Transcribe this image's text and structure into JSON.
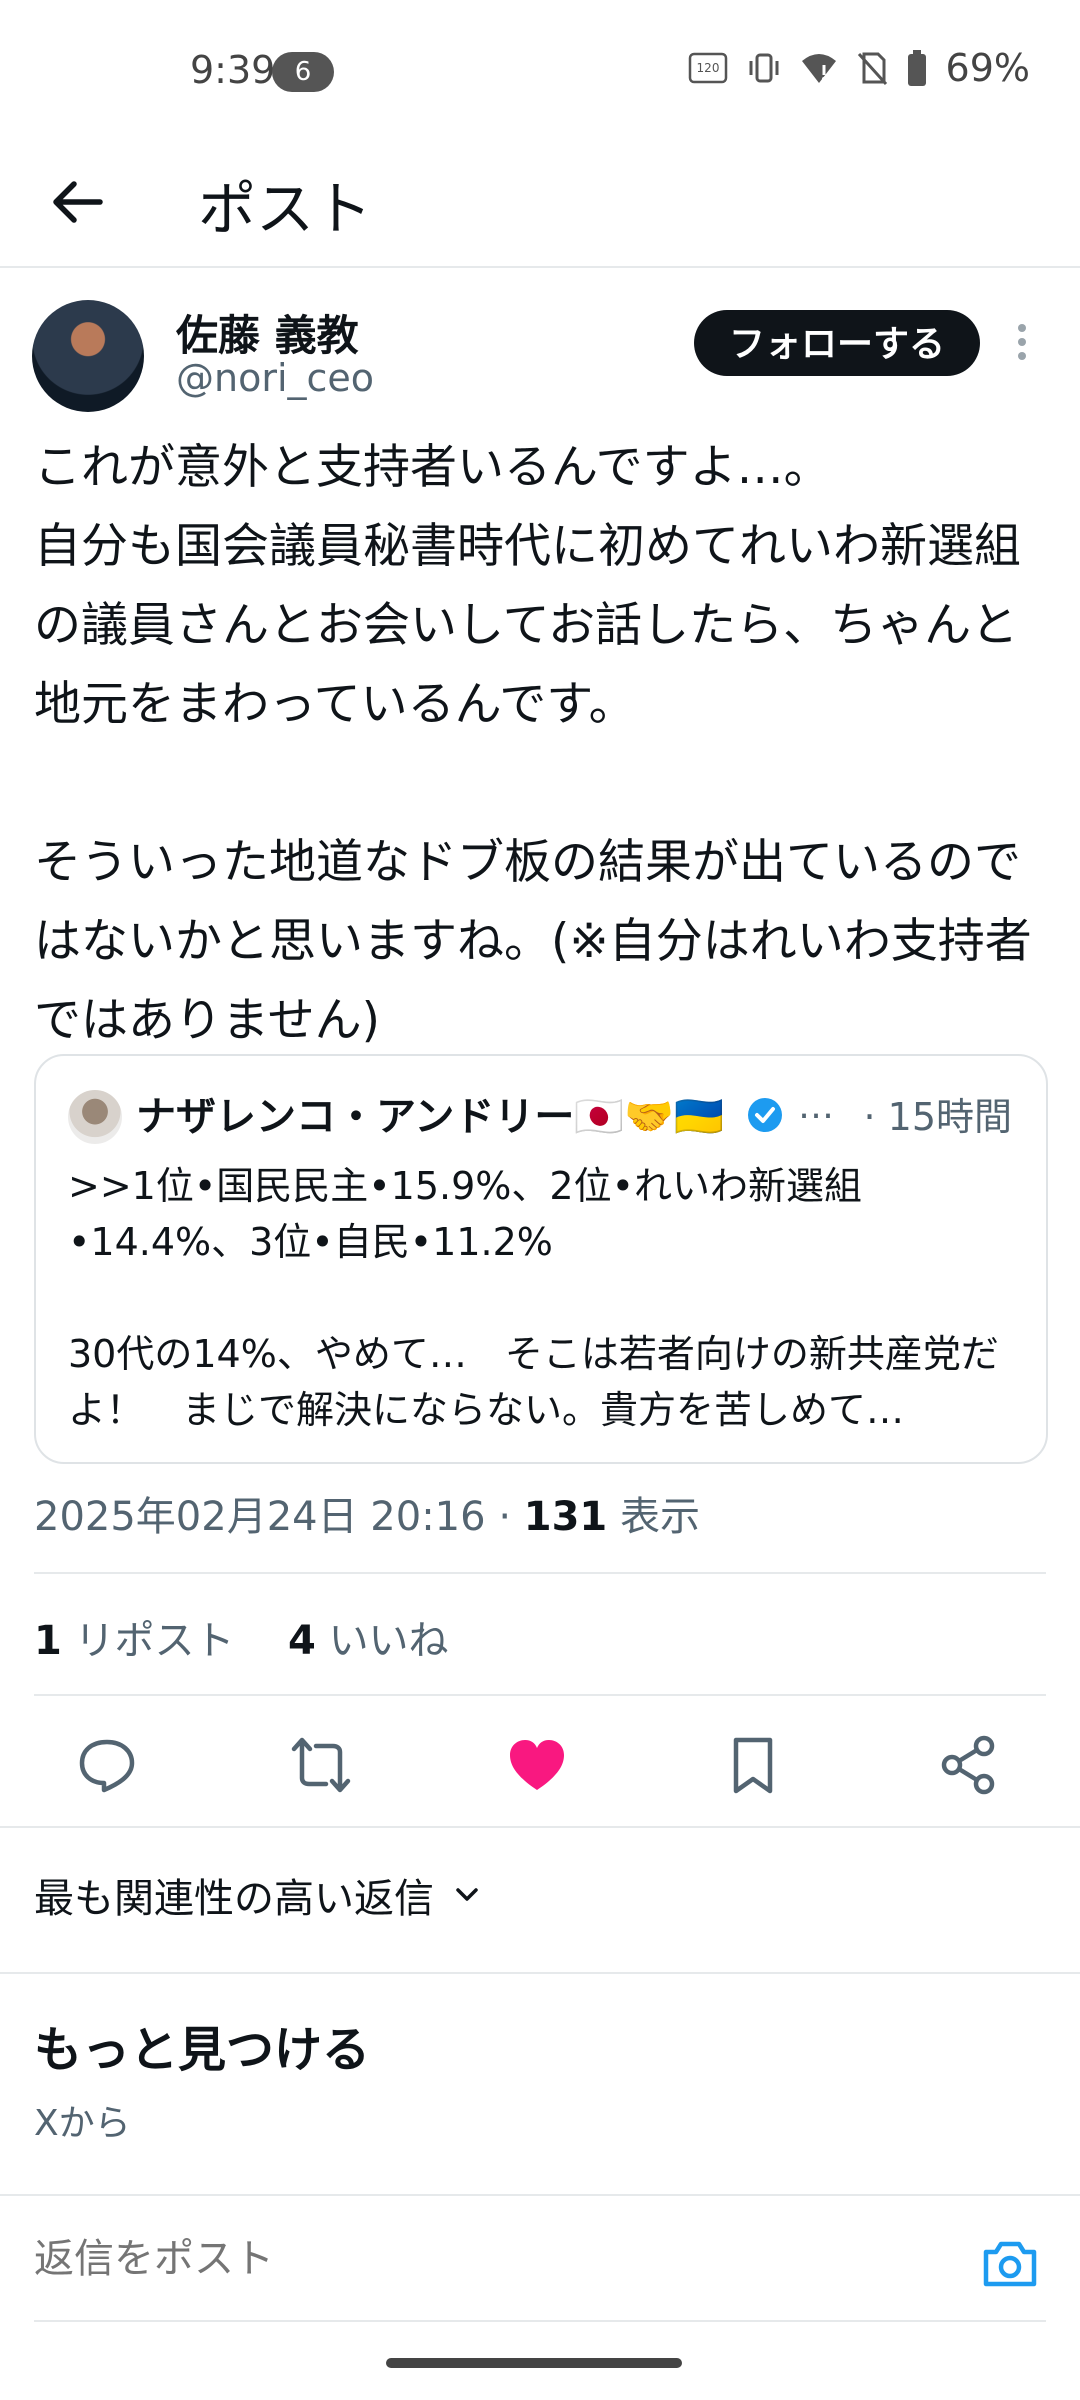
{
  "status_bar": {
    "time": "9:39",
    "notification_count": "6",
    "refresh_rate": "120",
    "battery": "69%",
    "icons": [
      "hz-icon",
      "vibrate-icon",
      "wifi-icon",
      "no-sim-icon",
      "battery-icon"
    ]
  },
  "header": {
    "title": "ポスト"
  },
  "post": {
    "author_name": "佐藤 義教",
    "author_handle": "@nori_ceo",
    "follow_label": "フォローする",
    "text": "これが意外と支持者いるんですよ…。\n自分も国会議員秘書時代に初めてれいわ新選組の議員さんとお会いしてお話したら、ちゃんと地元をまわっているんです。\n\nそういった地道なドブ板の結果が出ているのではないかと思いますね。(※自分はれいわ支持者ではありません)",
    "timestamp": "2025年02月24日 20:16",
    "separator": "·",
    "views_count": "131",
    "views_label": "表示"
  },
  "quote": {
    "author_name": "ナザレンコ・アンドリー🇯🇵🤝🇺🇦",
    "ellipsis": "…",
    "time": "· 15時間",
    "text": ">>1位•国民民主•15.9%、2位•れいわ新選組•14.4%、3位•自民•11.2%\n\n30代の14%、やめて…　そこは若者向けの新共産党だよ！　まじで解決にならない。貴方を苦しめて…"
  },
  "stats": {
    "reposts_count": "1",
    "reposts_label": "リポスト",
    "likes_count": "4",
    "likes_label": "いいね"
  },
  "actions": {
    "reply": "reply-icon",
    "repost": "repost-icon",
    "like": "like-icon",
    "bookmark": "bookmark-icon",
    "share": "share-icon",
    "like_color": "#f91880"
  },
  "replies_sort": {
    "label": "最も関連性の高い返信"
  },
  "discover": {
    "title": "もっと見つける",
    "subtitle": "Xから"
  },
  "reply_box": {
    "placeholder": "返信をポスト"
  },
  "colors": {
    "accent": "#1d9bf0",
    "text": "#0f1419",
    "muted": "#536471"
  }
}
